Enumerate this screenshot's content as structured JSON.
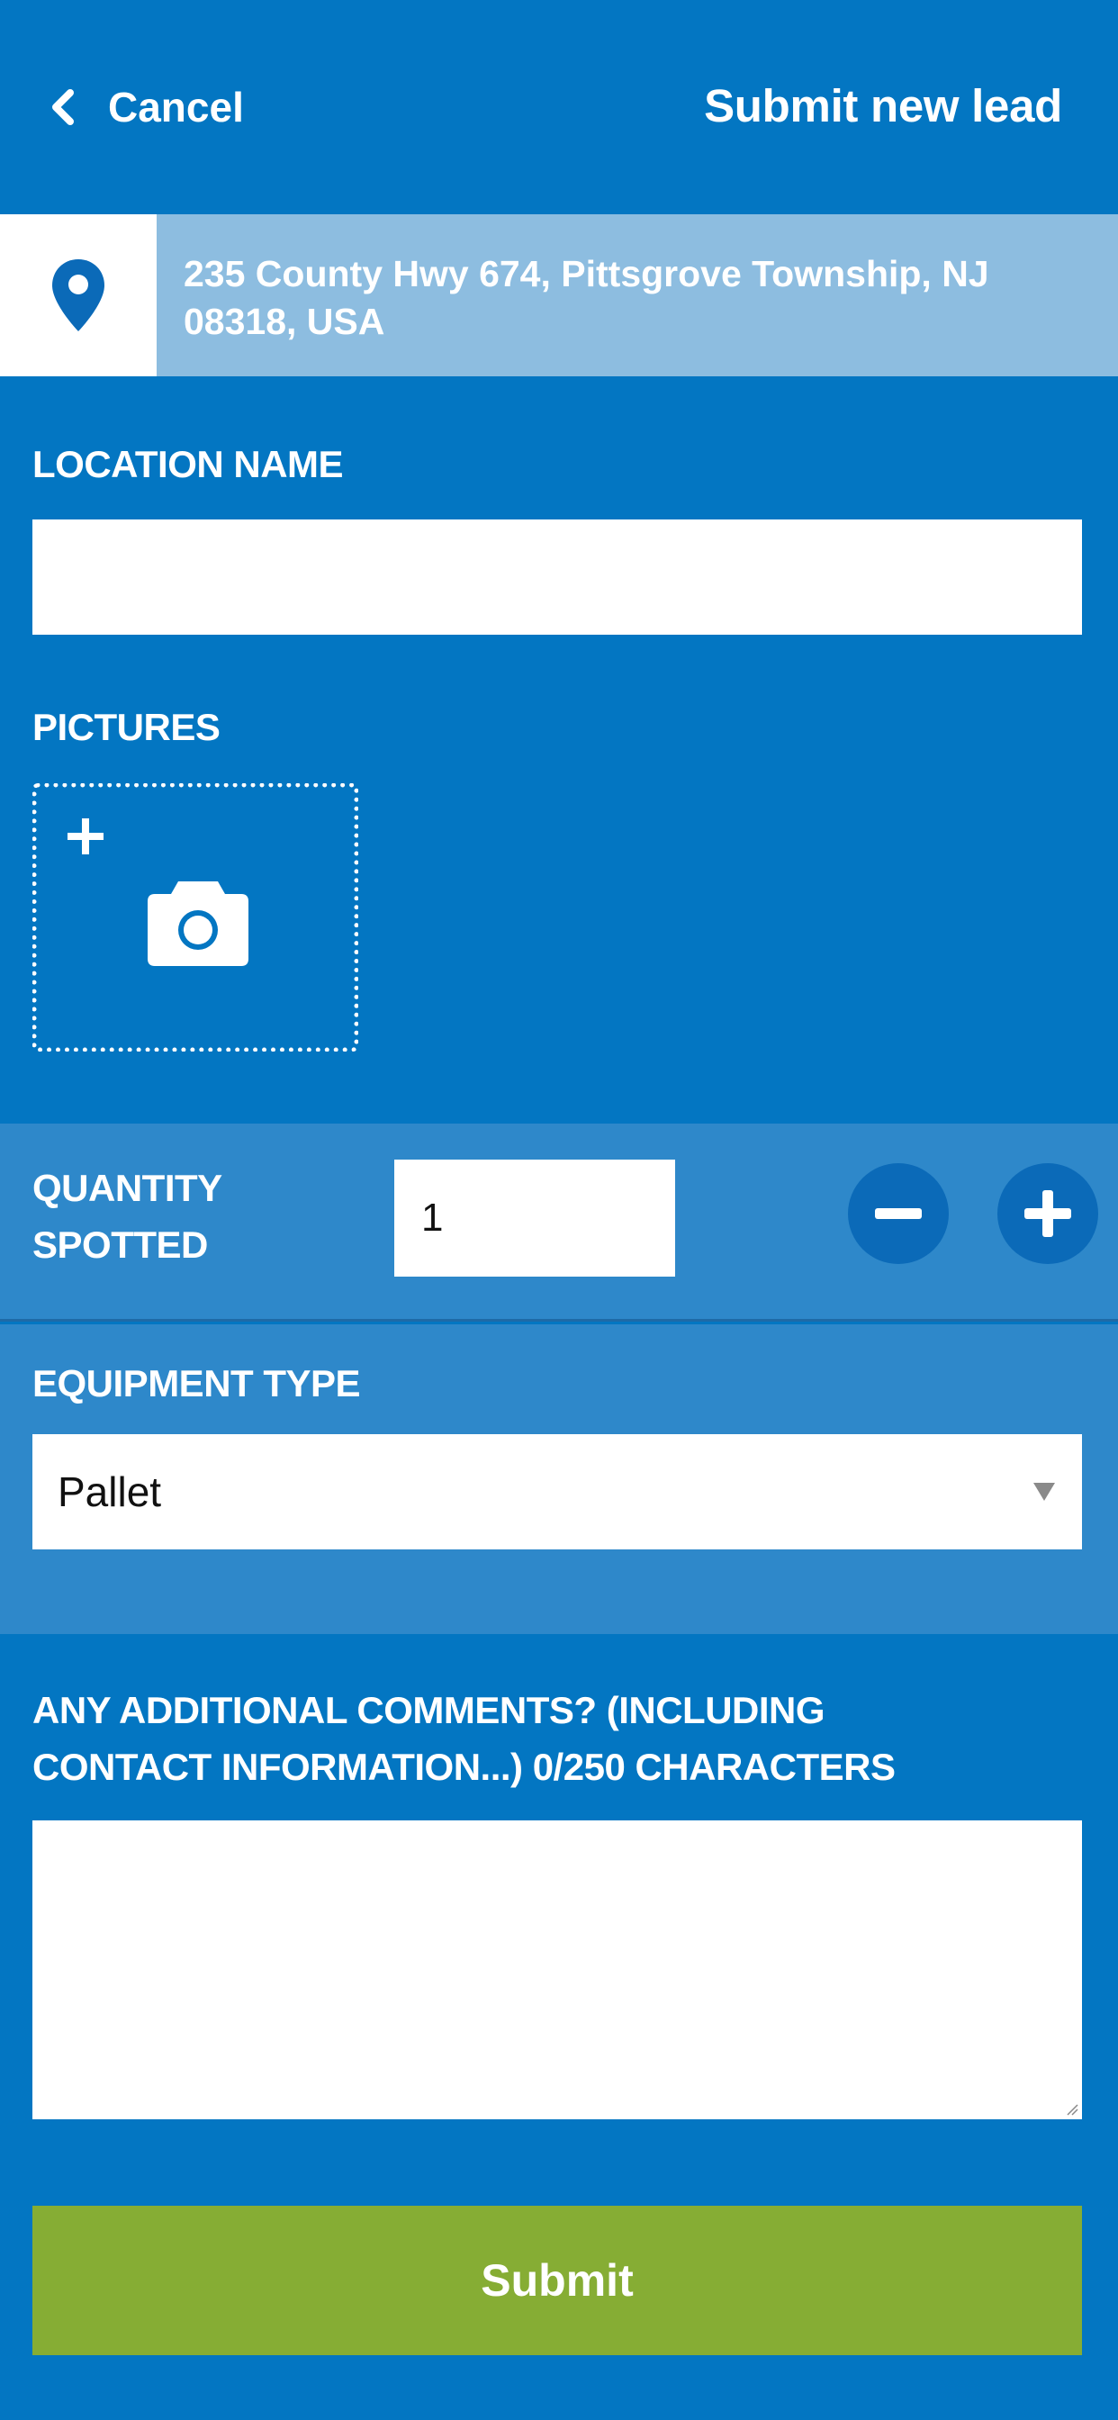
{
  "header": {
    "cancel_label": "Cancel",
    "title": "Submit new lead"
  },
  "address": {
    "text": "235 County Hwy 674, Pittsgrove Township, NJ 08318, USA",
    "icon": "map-pin-icon"
  },
  "location_name": {
    "label": "LOCATION NAME",
    "value": ""
  },
  "pictures": {
    "label": "PICTURES",
    "icons": [
      "plus-icon",
      "camera-icon"
    ]
  },
  "quantity": {
    "label_line1": "QUANTITY",
    "label_line2": "SPOTTED",
    "value": "1",
    "decrement_icon": "minus-icon",
    "increment_icon": "plus-icon"
  },
  "equipment": {
    "label": "EQUIPMENT TYPE",
    "selected": "Pallet"
  },
  "comments": {
    "label_line1": "ANY ADDITIONAL COMMENTS? (INCLUDING",
    "label_line2": "CONTACT INFORMATION...) 0/250 CHARACTERS",
    "value": ""
  },
  "submit": {
    "label": "Submit"
  },
  "colors": {
    "background": "#0376c2",
    "band": "#2e88ca",
    "address_bg": "#8dbde0",
    "submit_green": "#86ad34",
    "round_button": "#0b6ab8"
  }
}
